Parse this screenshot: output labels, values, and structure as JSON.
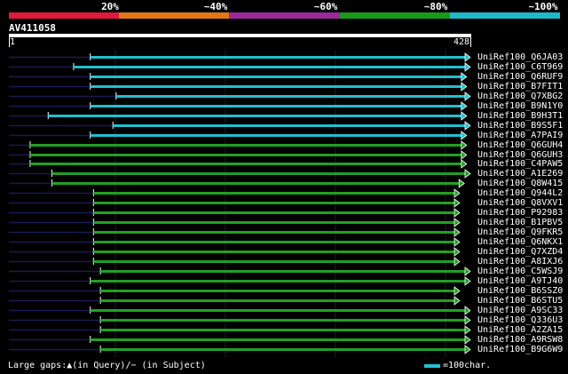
{
  "legend": {
    "labels": [
      "20%",
      "~40%",
      "~60%",
      "~80%",
      "~100%"
    ],
    "colors": [
      "#e01a3c",
      "#e0781a",
      "#9a2a9a",
      "#1a9a1a",
      "#20b8c8"
    ]
  },
  "query": {
    "name": "AV411058",
    "start": "1",
    "end": "428"
  },
  "hits": [
    {
      "name": "UniRef100_Q6JA03",
      "start_frac": 0.176,
      "end_frac": 0.998,
      "color": "cyan"
    },
    {
      "name": "UniRef100_C6T969",
      "start_frac": 0.14,
      "end_frac": 0.998,
      "color": "cyan"
    },
    {
      "name": "UniRef100_Q6RUF9",
      "start_frac": 0.176,
      "end_frac": 0.99,
      "color": "cyan"
    },
    {
      "name": "UniRef100_B7FIT1",
      "start_frac": 0.176,
      "end_frac": 0.99,
      "color": "cyan"
    },
    {
      "name": "UniRef100_Q7XBG2",
      "start_frac": 0.232,
      "end_frac": 0.998,
      "color": "cyan"
    },
    {
      "name": "UniRef100_B9N1Y0",
      "start_frac": 0.176,
      "end_frac": 0.99,
      "color": "cyan"
    },
    {
      "name": "UniRef100_B9H3T1",
      "start_frac": 0.085,
      "end_frac": 0.99,
      "color": "cyan"
    },
    {
      "name": "UniRef100_B9S5F1",
      "start_frac": 0.225,
      "end_frac": 0.998,
      "color": "cyan"
    },
    {
      "name": "UniRef100_A7PAI9",
      "start_frac": 0.176,
      "end_frac": 0.99,
      "color": "cyan"
    },
    {
      "name": "UniRef100_Q6GUH4",
      "start_frac": 0.046,
      "end_frac": 0.99,
      "color": "green"
    },
    {
      "name": "UniRef100_Q6GUH3",
      "start_frac": 0.046,
      "end_frac": 0.99,
      "color": "green"
    },
    {
      "name": "UniRef100_C4PAW5",
      "start_frac": 0.046,
      "end_frac": 0.99,
      "color": "green"
    },
    {
      "name": "UniRef100_A1E269",
      "start_frac": 0.093,
      "end_frac": 0.998,
      "color": "green"
    },
    {
      "name": "UniRef100_Q8W415",
      "start_frac": 0.093,
      "end_frac": 0.985,
      "color": "green"
    },
    {
      "name": "UniRef100_Q944L2",
      "start_frac": 0.183,
      "end_frac": 0.975,
      "color": "green"
    },
    {
      "name": "UniRef100_Q8VXV1",
      "start_frac": 0.183,
      "end_frac": 0.975,
      "color": "green"
    },
    {
      "name": "UniRef100_P92983",
      "start_frac": 0.183,
      "end_frac": 0.975,
      "color": "green"
    },
    {
      "name": "UniRef100_B1PBV5",
      "start_frac": 0.183,
      "end_frac": 0.975,
      "color": "green"
    },
    {
      "name": "UniRef100_Q9FKR5",
      "start_frac": 0.183,
      "end_frac": 0.975,
      "color": "green"
    },
    {
      "name": "UniRef100_Q6NKX1",
      "start_frac": 0.183,
      "end_frac": 0.975,
      "color": "green"
    },
    {
      "name": "UniRef100_Q7XZD4",
      "start_frac": 0.183,
      "end_frac": 0.975,
      "color": "green"
    },
    {
      "name": "UniRef100_A8IXJ6",
      "start_frac": 0.183,
      "end_frac": 0.975,
      "color": "green"
    },
    {
      "name": "UniRef100_C5WSJ9",
      "start_frac": 0.198,
      "end_frac": 0.998,
      "color": "green"
    },
    {
      "name": "UniRef100_A9TJ40",
      "start_frac": 0.176,
      "end_frac": 0.998,
      "color": "green"
    },
    {
      "name": "UniRef100_B6SSZ0",
      "start_frac": 0.198,
      "end_frac": 0.975,
      "color": "green"
    },
    {
      "name": "UniRef100_B6STU5",
      "start_frac": 0.198,
      "end_frac": 0.975,
      "color": "green"
    },
    {
      "name": "UniRef100_A9SC33",
      "start_frac": 0.176,
      "end_frac": 0.998,
      "color": "green"
    },
    {
      "name": "UniRef100_Q336U3",
      "start_frac": 0.198,
      "end_frac": 0.998,
      "color": "green"
    },
    {
      "name": "UniRef100_A2ZA15",
      "start_frac": 0.198,
      "end_frac": 0.998,
      "color": "green"
    },
    {
      "name": "UniRef100_A9RSW8",
      "start_frac": 0.176,
      "end_frac": 0.998,
      "color": "green"
    },
    {
      "name": "UniRef100_B9G6W9",
      "start_frac": 0.198,
      "end_frac": 0.998,
      "color": "green"
    }
  ],
  "footer": {
    "gaps_text": "Large gaps:▲(in Query)/− (in Subject)",
    "scale_text": "=100char."
  }
}
